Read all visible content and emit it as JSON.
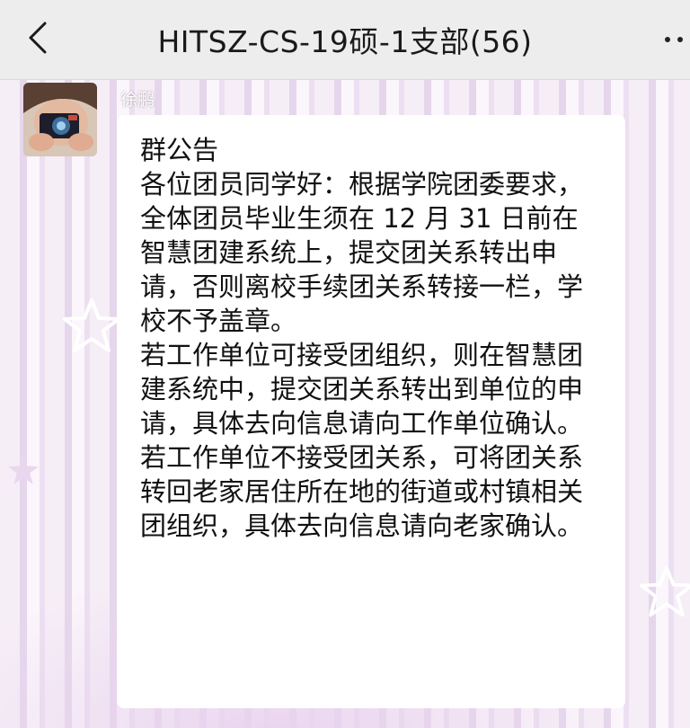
{
  "header": {
    "title": "HITSZ-CS-19硕-1支部(56)",
    "back_icon": "chevron-left-icon",
    "more_icon": "more-dots-icon"
  },
  "message": {
    "sender": "徐鹏",
    "notice_title": "群公告",
    "paragraphs": [
      "各位团员同学好：根据学院团委要求，全体团员毕业生须在 12 月 31 日前在智慧团建系统上，提交团关系转出申请，否则离校手续团关系转接一栏，学校不予盖章。",
      "若工作单位可接受团组织，则在智慧团建系统中，提交团关系转出到单位的申请，具体去向信息请向工作单位确认。",
      "若工作单位不接受团关系，可将团关系转回老家居住所在地的街道或村镇相关团组织，具体去向信息请向老家确认。"
    ]
  },
  "colors": {
    "topbar_bg": "#ededed",
    "bubble_bg": "#ffffff",
    "chat_bg": "#f3e9f5"
  }
}
